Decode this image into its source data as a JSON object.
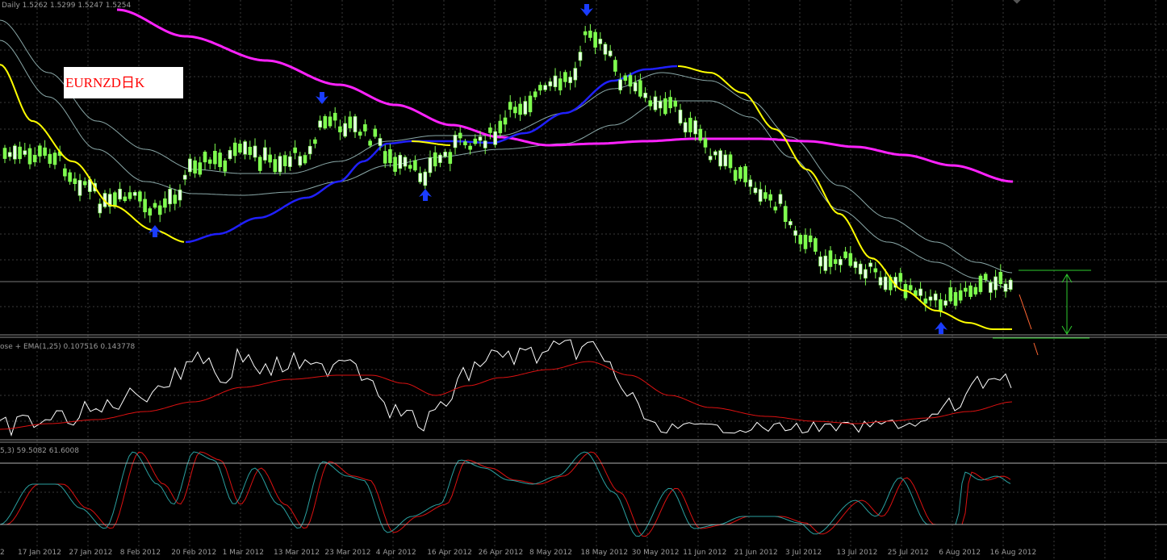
{
  "header": {
    "main_info": "Daily  1.5262 1.5299 1.5247 1.5254",
    "macd_info": "ose + EMA(1,25) 0.107516 0.143778",
    "stoch_info": "5,3) 59.5082 61.6008"
  },
  "symbol_label": "EURNZD日K",
  "colors": {
    "background": "#000000",
    "grid": "#3a3a3a",
    "candle_bull": "#e8ffe8",
    "candle_bear": "#7fff4f",
    "ma_yellow": "#ffff00",
    "ma_blue": "#2020ff",
    "ma_magenta": "#ff22ff",
    "envelope": "#8aa8a8",
    "arrows": "#1a3cff",
    "macd_main": "#ffffff",
    "macd_signal": "#dd1111",
    "stoch_main": "#2aa0a0",
    "stoch_signal": "#dd1111",
    "projection": "#2ecc2e",
    "forecast": "#ff6633"
  },
  "x_axis": {
    "labels": [
      "17 Jan 2012",
      "27 Jan 2012",
      "8 Feb 2012",
      "20 Feb 2012",
      "1 Mar 2012",
      "13 Mar 2012",
      "23 Mar 2012",
      "4 Apr 2012",
      "16 Apr 2012",
      "26 Apr 2012",
      "8 May 2012",
      "18 May 2012",
      "30 May 2012",
      "11 Jun 2012",
      "21 Jun 2012",
      "3 Jul 2012",
      "13 Jul 2012",
      "25 Jul 2012",
      "6 Aug 2012",
      "16 Aug 2012"
    ]
  },
  "chart_data": [
    {
      "type": "candlestick",
      "title": "EURNZD日K",
      "series": [
        {
          "name": "yellow MA",
          "values": [
            0.88,
            0.8,
            0.73,
            0.67,
            0.63,
            0.59,
            0.56,
            0.55,
            0.565,
            0.585,
            0.58,
            0.54,
            0.46,
            0.37,
            0.28,
            0.2,
            0.12,
            0.07,
            0.04,
            0.03
          ]
        },
        {
          "name": "blue MA",
          "values": [
            0.83,
            0.8,
            0.76,
            0.72,
            0.68,
            0.645,
            0.63,
            0.635,
            0.63,
            0.6,
            0.57,
            0.52,
            0.47,
            0.44,
            0.43,
            0.43,
            0.42,
            0.41,
            0.41,
            0.41
          ]
        },
        {
          "name": "magenta MA",
          "values": [
            0.92,
            0.98,
            0.95,
            0.91,
            0.86,
            0.81,
            0.77,
            0.73,
            0.69,
            0.66,
            0.64,
            0.61,
            0.58,
            0.55,
            0.52,
            0.49,
            0.47,
            0.45,
            0.43,
            0.42
          ]
        }
      ],
      "reference_levels": [
        0.42,
        0.0
      ]
    },
    {
      "type": "line",
      "title": "ose + EMA(1,25)",
      "series": [
        {
          "name": "MACD",
          "values": [
            0.107516
          ]
        },
        {
          "name": "EMA(1,25)",
          "values": [
            0.143778
          ]
        }
      ]
    },
    {
      "type": "line",
      "title": "Stochastic",
      "series": [
        {
          "name": "main",
          "values": [
            59.5082
          ]
        },
        {
          "name": "signal",
          "values": [
            61.6008
          ]
        }
      ],
      "levels": [
        80,
        20
      ]
    }
  ]
}
